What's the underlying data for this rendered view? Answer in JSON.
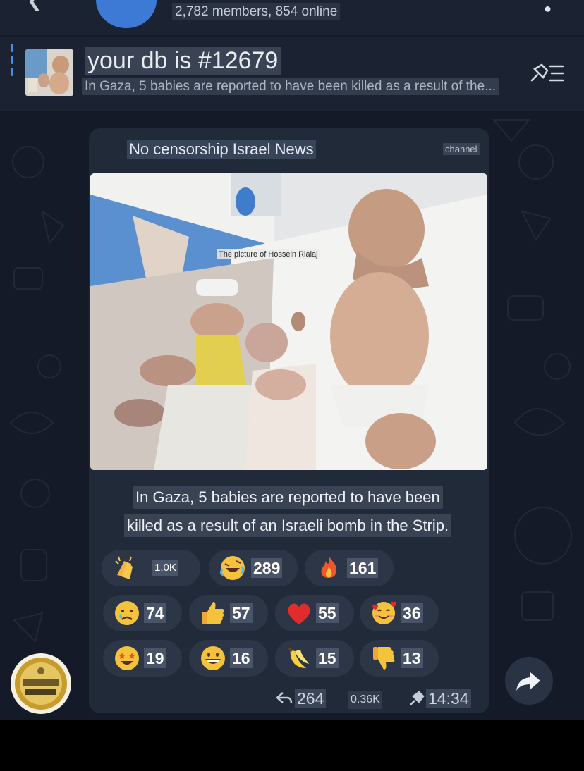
{
  "header": {
    "members": "2,782 members, 854 online"
  },
  "pinned": {
    "title": "your db is #12679",
    "preview": "In Gaza, 5 babies are reported to have been killed as a result of the..."
  },
  "message": {
    "sender": "No censorship Israel News",
    "tag": "channel",
    "photo_caption": "The picture of Hossein Rialaj",
    "text_line1": "In Gaza, 5 babies are reported to have been",
    "text_line2": "killed as a result of an Israeli bomb in the Strip.",
    "reactions": [
      {
        "icon": "clapping-hands-icon",
        "count": "1.0K"
      },
      {
        "icon": "rolling-laughing-face-icon",
        "count": "289"
      },
      {
        "icon": "fire-icon",
        "count": "161"
      },
      {
        "icon": "crying-face-icon",
        "count": "74"
      },
      {
        "icon": "thumbs-up-icon",
        "count": "57"
      },
      {
        "icon": "red-heart-icon",
        "count": "55"
      },
      {
        "icon": "smiling-face-hearts-icon",
        "count": "36"
      },
      {
        "icon": "star-struck-face-icon",
        "count": "19"
      },
      {
        "icon": "grinning-face-icon",
        "count": "16"
      },
      {
        "icon": "banana-icon",
        "count": "15"
      },
      {
        "icon": "thumbs-down-icon",
        "count": "13"
      }
    ],
    "replies": "264",
    "views": "0.36K",
    "time": "14:34"
  }
}
